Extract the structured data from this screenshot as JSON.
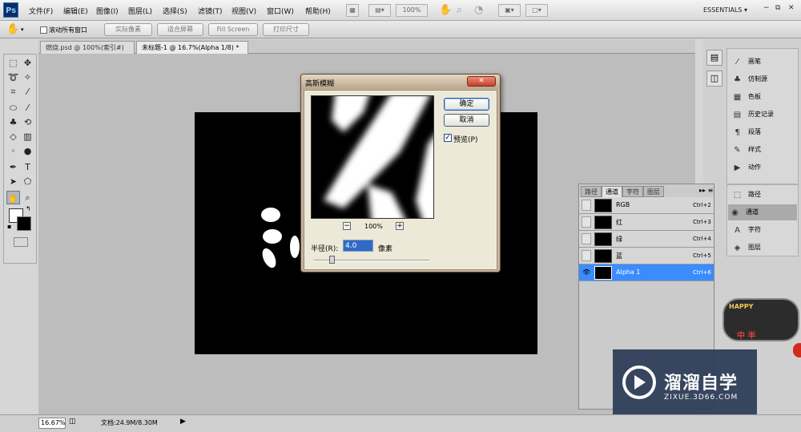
{
  "app": {
    "logo": "Ps"
  },
  "menu": [
    "文件(F)",
    "编辑(E)",
    "图像(I)",
    "图层(L)",
    "选择(S)",
    "滤镜(T)",
    "视图(V)",
    "窗口(W)",
    "帮助(H)"
  ],
  "menubar": {
    "zoom": "100%",
    "workspace": "ESSENTIALS ▾"
  },
  "options": {
    "scroll_all": "滚动所有窗口",
    "buttons": [
      "实际像素",
      "适合屏幕",
      "Fill Screen",
      "打印尺寸"
    ]
  },
  "tabs": [
    "燃烧.psd @ 100%(索引#)",
    "未标题-1 @ 16.7%(Alpha 1/8) *"
  ],
  "dialog": {
    "title": "高斯模糊",
    "ok": "确定",
    "cancel": "取消",
    "preview_label": "预览(P)",
    "preview_checked": true,
    "zoom": "100%",
    "zoom_minus": "−",
    "zoom_plus": "+",
    "radius_label": "半径(R):",
    "radius_value": "4.0",
    "unit": "像素",
    "radius_fraction": 0.15
  },
  "right_panels": [
    {
      "icon": "brush-icon",
      "label": "画笔"
    },
    {
      "icon": "clone-source-icon",
      "label": "仿制源"
    },
    {
      "icon": "swatches-icon",
      "label": "色板"
    },
    {
      "icon": "history-icon",
      "label": "历史记录"
    },
    {
      "icon": "paragraph-icon",
      "label": "段落"
    },
    {
      "icon": "styles-icon",
      "label": "样式"
    },
    {
      "icon": "actions-icon",
      "label": "动作"
    }
  ],
  "right_panels2": [
    {
      "icon": "paths-icon",
      "label": "路径"
    },
    {
      "icon": "channels-icon",
      "label": "通道"
    },
    {
      "icon": "character-icon",
      "label": "字符"
    },
    {
      "icon": "layers-icon",
      "label": "图层"
    }
  ],
  "channels_panel": {
    "tabs": [
      "路径",
      "通道",
      "字符",
      "图层"
    ],
    "rows": [
      {
        "name": "RGB",
        "shortcut": "Ctrl+2",
        "visible": false
      },
      {
        "name": "红",
        "shortcut": "Ctrl+3",
        "visible": false
      },
      {
        "name": "绿",
        "shortcut": "Ctrl+4",
        "visible": false
      },
      {
        "name": "蓝",
        "shortcut": "Ctrl+5",
        "visible": false
      },
      {
        "name": "Alpha 1",
        "shortcut": "Ctrl+6",
        "visible": true
      }
    ]
  },
  "status": {
    "zoom": "16.67%",
    "doc": "文档:24.9M/8.30M"
  },
  "watermark": {
    "title": "溜溜自学",
    "sub": "ZIXUE.3D66.COM"
  },
  "sticker": {
    "text1": "HAPPY",
    "text2": "中 半"
  },
  "colors": {
    "selection": "#3b8cff",
    "canvas": "#000000",
    "dialog_frame": "#c2b39e",
    "watermark": "#2b3a55"
  }
}
